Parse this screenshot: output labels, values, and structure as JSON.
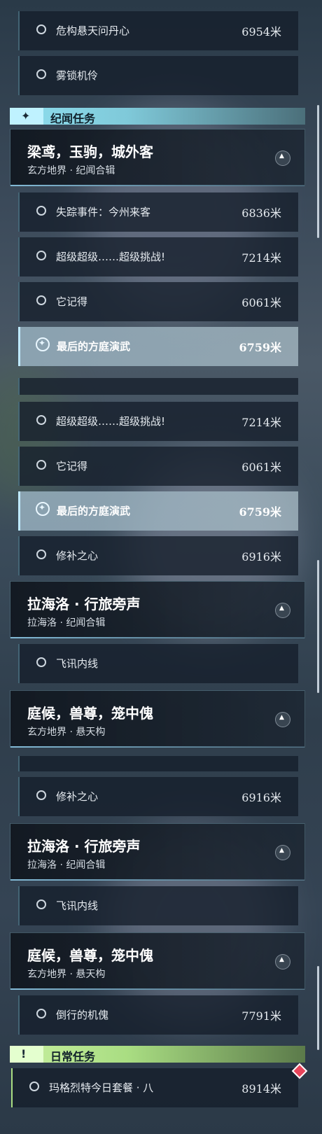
{
  "panel1": {
    "rows_top": [
      {
        "label": "危构悬天问丹心",
        "distance": "6954米"
      },
      {
        "label": "雾锁机伶",
        "distance": ""
      }
    ],
    "section": {
      "title": "纪闻任务",
      "icon": "sparkle-icon"
    },
    "card": {
      "title": "梁鸢，玉驹，城外客",
      "subtitle": "玄方地界 · 纪闻合辑"
    },
    "rows": [
      {
        "label": "失踪事件：今州来客",
        "distance": "6836米"
      },
      {
        "label": "超级超级……超级挑战!",
        "distance": "7214米"
      },
      {
        "label": "它记得",
        "distance": "6061米"
      },
      {
        "label": "最后的方庭演武",
        "distance": "6759米",
        "active": true
      }
    ]
  },
  "panel2": {
    "rows": [
      {
        "label": "超级超级……超级挑战!",
        "distance": "7214米"
      },
      {
        "label": "它记得",
        "distance": "6061米"
      },
      {
        "label": "最后的方庭演武",
        "distance": "6759米",
        "active": true
      },
      {
        "label": "修补之心",
        "distance": "6916米"
      }
    ],
    "card1": {
      "title": "拉海洛 · 行旅旁声",
      "subtitle": "拉海洛 · 纪闻合辑"
    },
    "row_after_card1": {
      "label": "飞讯内线",
      "distance": ""
    },
    "card2": {
      "title": "庭候，兽尊，笼中傀",
      "subtitle": "玄方地界 · 悬天构"
    }
  },
  "panel3": {
    "row_top": {
      "label": "修补之心",
      "distance": "6916米"
    },
    "card1": {
      "title": "拉海洛 · 行旅旁声",
      "subtitle": "拉海洛 · 纪闻合辑"
    },
    "row_after_card1": {
      "label": "飞讯内线",
      "distance": ""
    },
    "card2": {
      "title": "庭候，兽尊，笼中傀",
      "subtitle": "玄方地界 · 悬天构"
    },
    "row_after_card2": {
      "label": "倒行的机傀",
      "distance": "7791米"
    },
    "section": {
      "title": "日常任务",
      "icon": "exclamation-icon"
    },
    "daily": {
      "label": "玛格烈特今日套餐 · 八",
      "distance": "8914米"
    }
  },
  "colors": {
    "accent": "#8fdfef",
    "daily_accent": "#a9dd82",
    "marker": "#e8445a"
  }
}
